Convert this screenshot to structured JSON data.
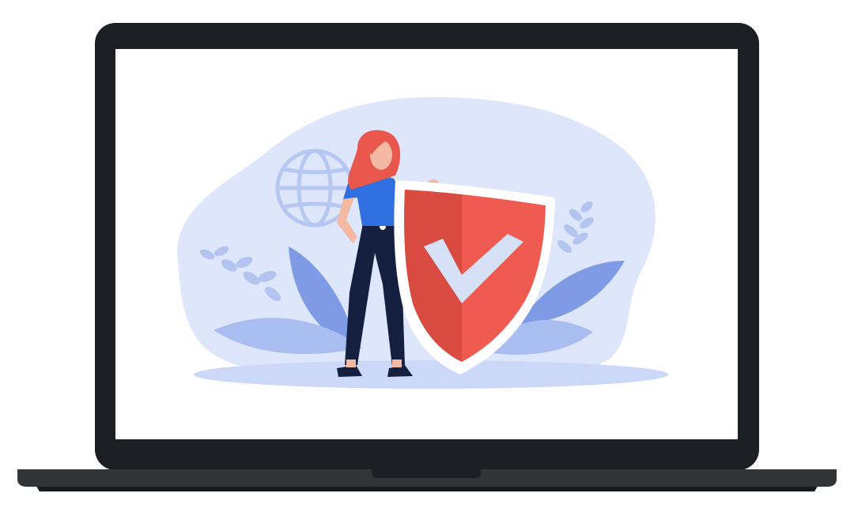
{
  "colors": {
    "bezel": "#1b1f24",
    "screen": "#ffffff",
    "base": "#333436",
    "base_shadow": "#1a1a1a",
    "blob": "#dde6fb",
    "ground": "#ccd8f7",
    "globe": "#b6c7f2",
    "leaf_dark": "#7f9be6",
    "leaf_light": "#a9bdf1",
    "sprig": "#b3c4f0",
    "shield_red": "#ef5b50",
    "shield_dark": "#d94a40",
    "shield_rim": "#ffffff",
    "check": "#d6e1f8",
    "hair": "#e9564c",
    "skin": "#f4b9a2",
    "shirt": "#2f6fe0",
    "pants": "#152041",
    "shoe": "#152041"
  },
  "icons": {
    "laptop": "laptop-icon",
    "shield": "shield-check-icon",
    "globe": "globe-icon"
  }
}
